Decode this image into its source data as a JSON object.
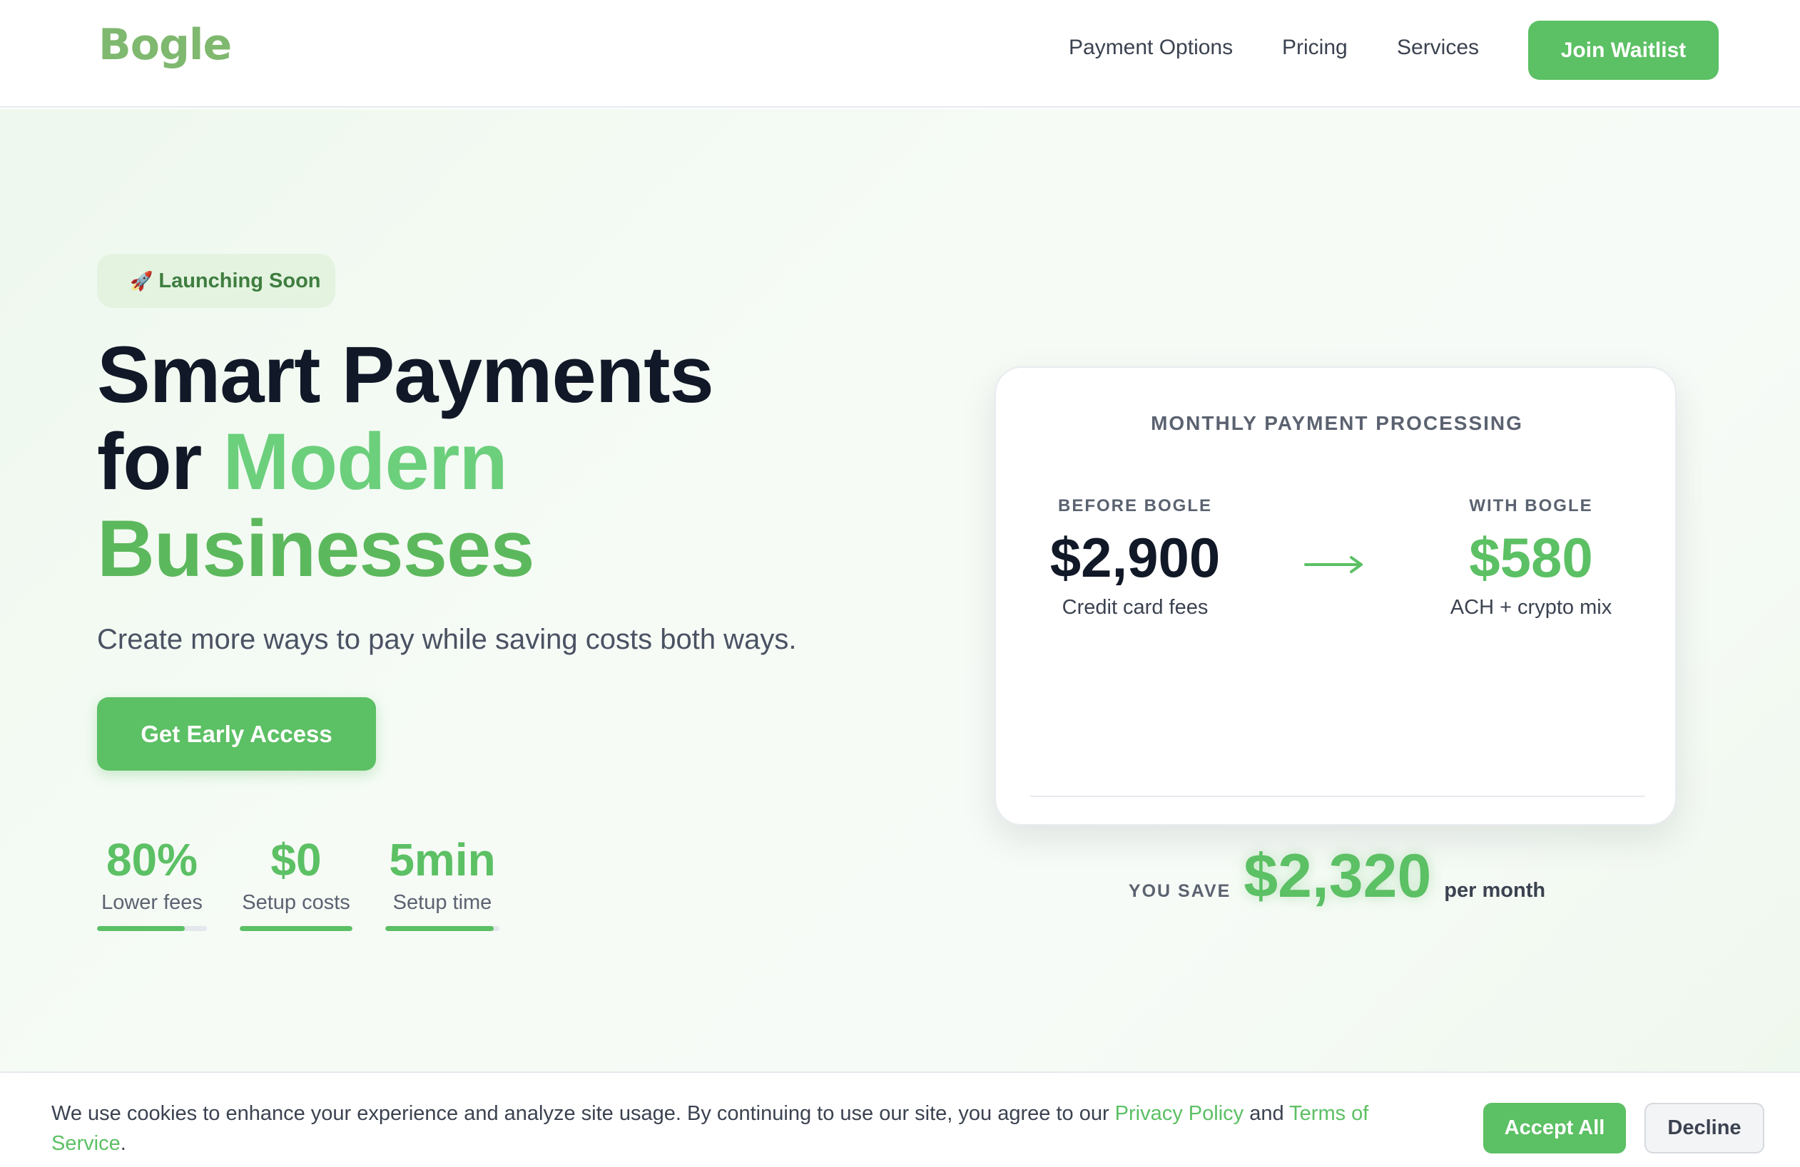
{
  "header": {
    "logo": "Bogle",
    "nav": [
      "Payment Options",
      "Pricing",
      "Services"
    ],
    "join_label": "Join Waitlist"
  },
  "hero": {
    "badge_icon": "rocket-icon",
    "badge_label": "Launching Soon",
    "headline_line1": "Smart Payments",
    "headline_for": "for ",
    "headline_green1": "Modern",
    "headline_green2": "Businesses",
    "subline": "Create more ways to pay while saving costs both ways.",
    "cta_label": "Get Early Access",
    "stats": [
      {
        "value": "80%",
        "label": "Lower fees",
        "progress": 0.8
      },
      {
        "value": "$0",
        "label": "Setup costs",
        "progress": 1.0
      },
      {
        "value": "5min",
        "label": "Setup time",
        "progress": 0.95
      }
    ]
  },
  "card": {
    "title": "MONTHLY PAYMENT PROCESSING",
    "before_caption": "BEFORE BOGLE",
    "before_amount": "$2,900",
    "before_desc": "Credit card fees",
    "arrow_icon": "arrow-right-icon",
    "after_caption": "WITH BOGLE",
    "after_amount": "$580",
    "after_desc": "ACH + crypto mix",
    "you_save": "YOU SAVE",
    "savings": "$2,320",
    "per_month": "per month"
  },
  "cookie": {
    "text_before": "We use cookies to enhance your experience and analyze site usage. By continuing to use our site, you agree to our ",
    "privacy_link": "Privacy Policy",
    "text_and": " and ",
    "terms_link": "Terms of Service",
    "text_end": ".",
    "accept_label": "Accept All",
    "decline_label": "Decline"
  },
  "colors": {
    "accent": "#5cc064",
    "dark_text": "#111827",
    "muted_text": "#5b6270"
  }
}
